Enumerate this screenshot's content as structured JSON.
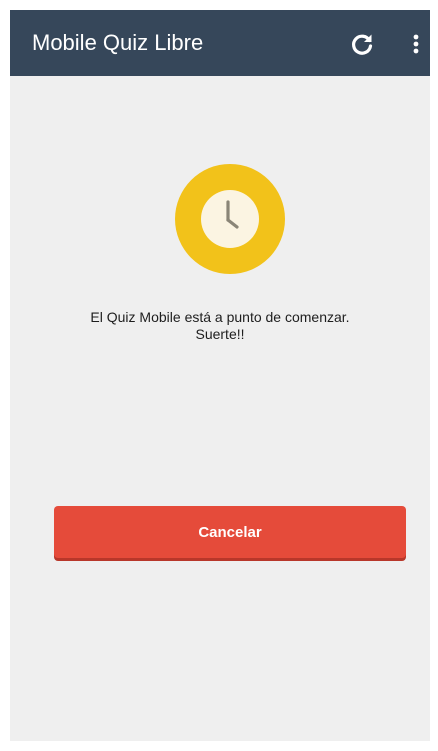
{
  "app_bar": {
    "title": "Mobile Quiz Libre",
    "refresh_icon": "refresh-icon",
    "menu_icon": "more-vert-icon",
    "background": "#36475a"
  },
  "content": {
    "clock_icon": "clock-icon",
    "message_line1": "El Quiz Mobile está a punto de comenzar.",
    "message_line2": "Suerte!!",
    "cancel_label": "Cancelar"
  },
  "colors": {
    "accent_yellow": "#f2c21a",
    "button_red": "#e54b3a",
    "background": "#efefef"
  }
}
